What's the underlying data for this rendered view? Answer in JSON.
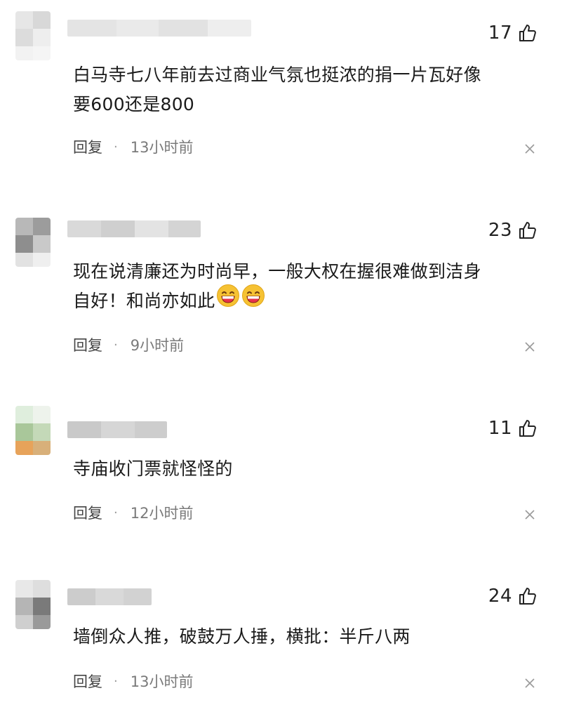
{
  "comments": [
    {
      "likes": "17",
      "text_lines": [
        "白马寺七八年前去过商业气氛也挺浓的捐一片瓦好像",
        "要600还是800"
      ],
      "emoji_count": 0,
      "reply_label": "回复",
      "separator": "·",
      "time": "13小时前"
    },
    {
      "likes": "23",
      "text_lines": [
        "现在说清廉还为时尚早，一般大权在握很难做到洁身",
        "自好！和尚亦如此"
      ],
      "emoji_count": 2,
      "reply_label": "回复",
      "separator": "·",
      "time": "9小时前"
    },
    {
      "likes": "11",
      "text_lines": [
        "寺庙收门票就怪怪的"
      ],
      "emoji_count": 0,
      "reply_label": "回复",
      "separator": "·",
      "time": "12小时前"
    },
    {
      "likes": "24",
      "text_lines": [
        "墙倒众人推，破鼓万人捶，横批：半斤八两"
      ],
      "emoji_count": 0,
      "reply_label": "回复",
      "separator": "·",
      "time": "13小时前"
    }
  ],
  "icons": {
    "like": "thumbs-up-icon",
    "close": "close-icon",
    "emoji": "grinning-face-icon"
  },
  "colors": {
    "text": "#1a1a1a",
    "meta": "#7a7a7a",
    "emoji_face": "#f6c233",
    "emoji_mouth": "#e8334a"
  }
}
